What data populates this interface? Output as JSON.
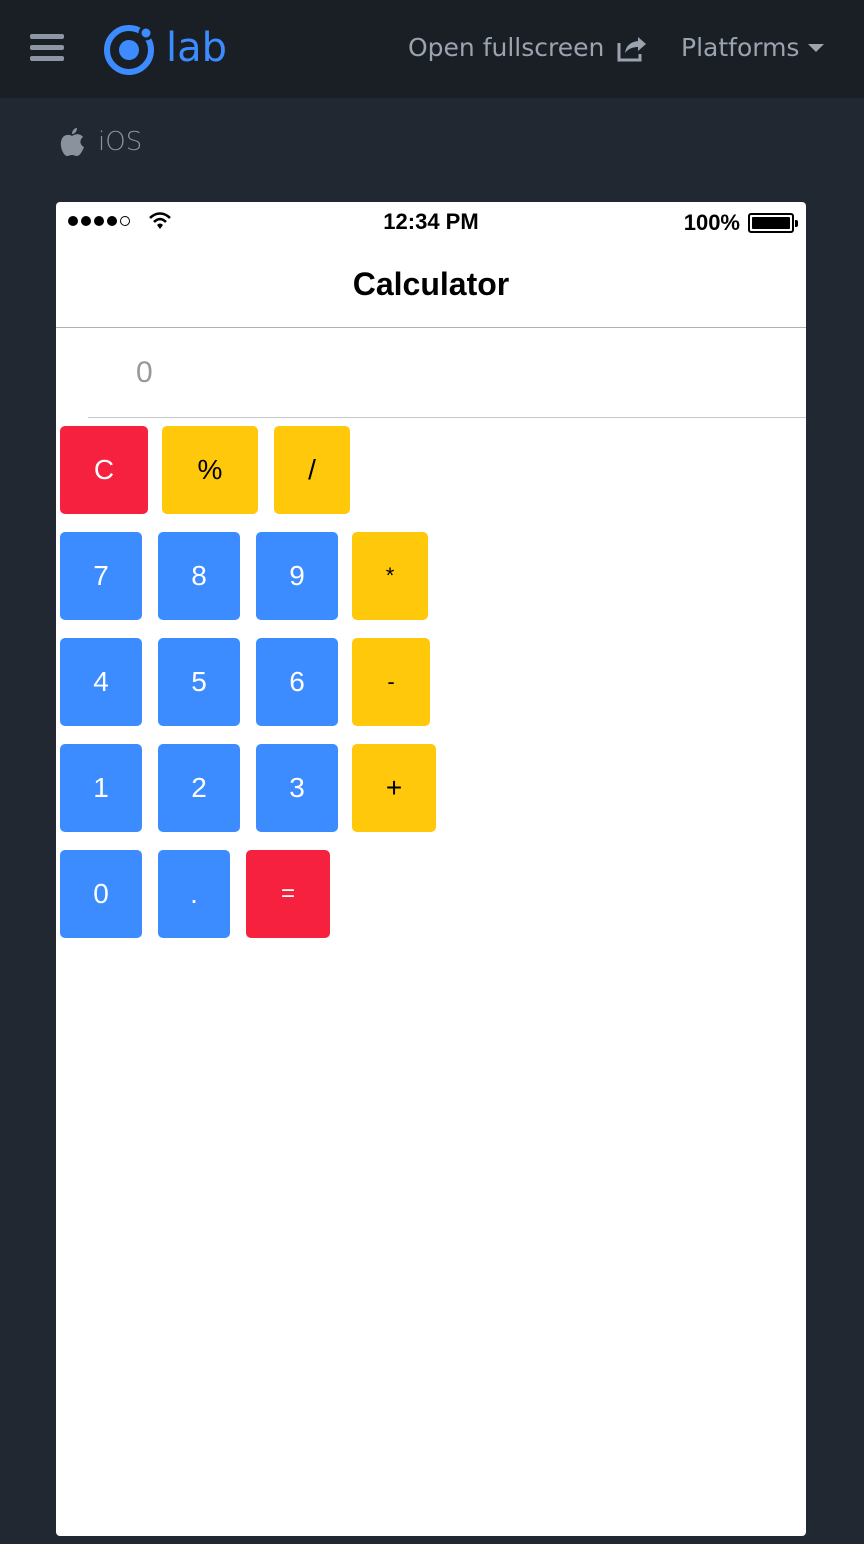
{
  "topbar": {
    "brand": "lab",
    "open_fullscreen": "Open fullscreen",
    "platforms": "Platforms"
  },
  "platform_label": "iOS",
  "device": {
    "status": {
      "time": "12:34 PM",
      "battery": "100%"
    },
    "nav_title": "Calculator",
    "display": {
      "placeholder": "0"
    },
    "keys": {
      "clear": "C",
      "percent": "%",
      "divide": "/",
      "seven": "7",
      "eight": "8",
      "nine": "9",
      "multiply": "*",
      "four": "4",
      "five": "5",
      "six": "6",
      "minus": "-",
      "one": "1",
      "two": "2",
      "three": "3",
      "plus": "+",
      "zero": "0",
      "decimal": ".",
      "equals": "="
    }
  },
  "colors": {
    "accent_blue": "#3d8cff",
    "operator_yellow": "#ffc80a",
    "danger_red": "#f5213f",
    "page_bg": "#222831"
  },
  "icons": [
    "menu-icon",
    "ionic-logo-icon",
    "external-link-icon",
    "caret-down-icon",
    "apple-icon",
    "wifi-icon",
    "battery-icon"
  ]
}
